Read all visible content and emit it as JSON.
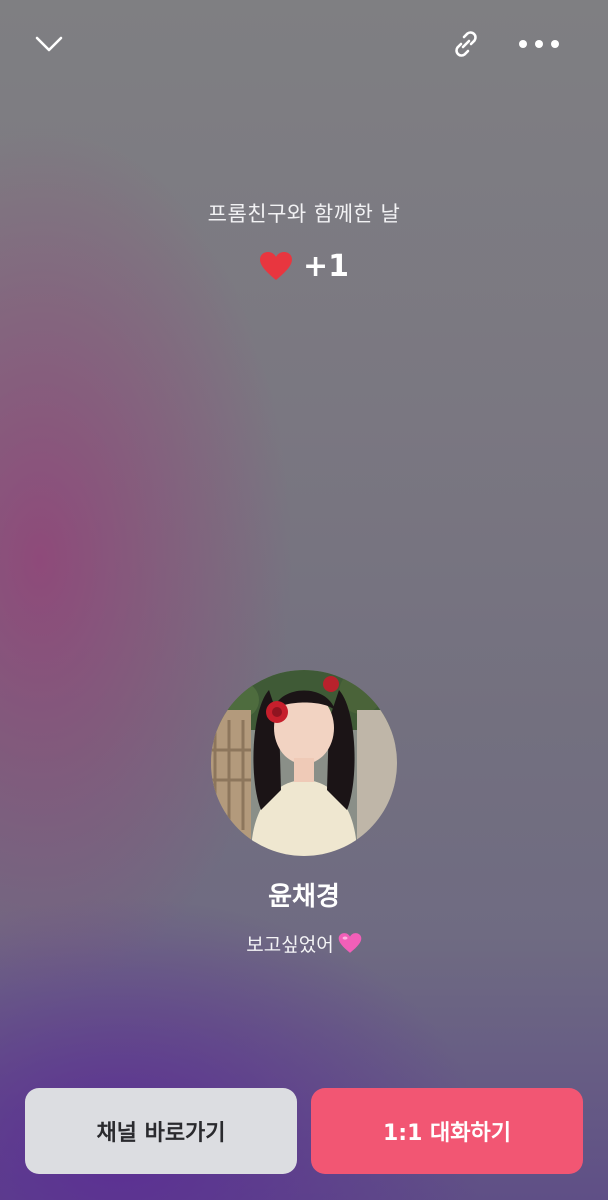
{
  "header": {
    "back_icon": "chevron-down-icon",
    "link_icon": "link-icon",
    "more_icon": "more-horizontal-icon"
  },
  "post": {
    "title": "프롬친구와 함께한 날",
    "like_icon": "heart-icon",
    "like_color": "#e8363f",
    "like_count": "+1"
  },
  "profile": {
    "name": "윤채경",
    "status_text": "보고싶었어",
    "status_emoji": "pink-heart-icon",
    "status_emoji_color": "#f25fb8"
  },
  "actions": {
    "channel_label": "채널 바로가기",
    "chat_label": "1:1 대화하기",
    "chat_color": "#f25673"
  }
}
